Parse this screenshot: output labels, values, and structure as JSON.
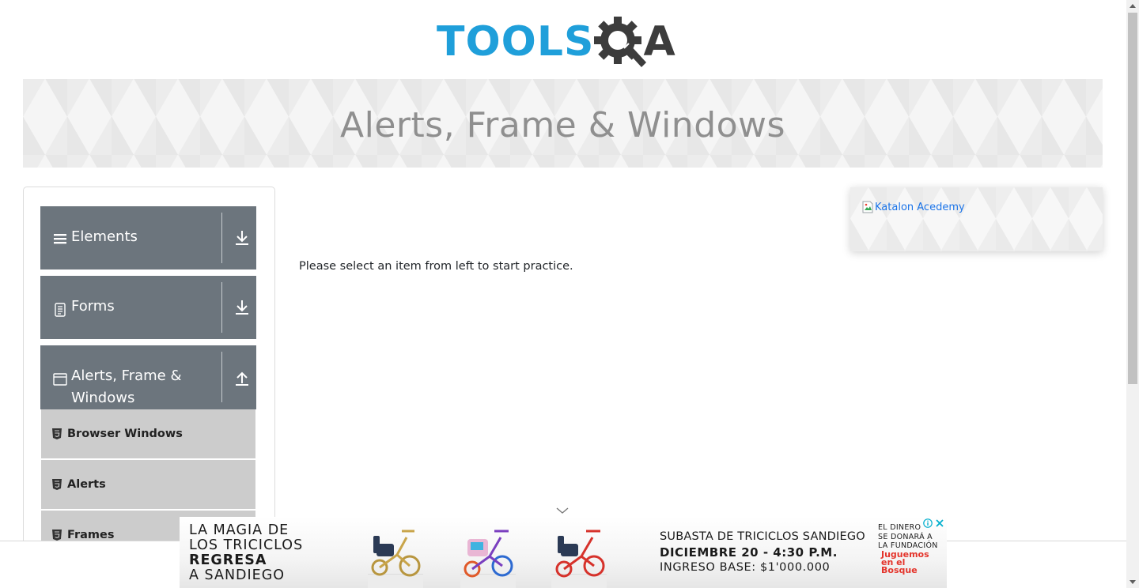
{
  "header": {
    "logo_tools": "TOOLS",
    "logo_qa": "A",
    "logo_colors": {
      "tools": "#1f9fda",
      "qa": "#3c3c3c"
    }
  },
  "banner": {
    "title": "Alerts, Frame & Windows"
  },
  "sidebar": {
    "groups": [
      {
        "label": "Elements",
        "icon": "hamburger-icon",
        "toggle_icon": "download-arrow-icon",
        "expanded": false
      },
      {
        "label": "Forms",
        "icon": "document-icon",
        "toggle_icon": "download-arrow-icon",
        "expanded": false
      },
      {
        "label": "Alerts, Frame & Windows",
        "icon": "window-icon",
        "toggle_icon": "upload-arrow-icon",
        "expanded": true
      }
    ],
    "sub_items": [
      {
        "label": "Browser Windows",
        "icon": "html5-icon"
      },
      {
        "label": "Alerts",
        "icon": "html5-icon"
      },
      {
        "label": "Frames",
        "icon": "html5-icon"
      }
    ],
    "group_color": "#6c757d",
    "sub_item_color": "#cccccc"
  },
  "main": {
    "instruction": "Please select an item from left to start practice."
  },
  "side_ad": {
    "image_alt": "Katalon Acedemy"
  },
  "bottom_ad": {
    "left_lines": [
      "LA MAGIA DE",
      "LOS TRICICLOS",
      "REGRESA",
      "A SANDIEGO"
    ],
    "middle_lines": [
      "SUBASTA DE TRICICLOS SANDIEGO",
      "DICIEMBRE 20 - 4:30 P.M.",
      "INGRESO BASE: $1'000.000"
    ],
    "right_lines": [
      "EL DINERO",
      "SE DONARÁ A",
      "LA FUNDACIÓN"
    ],
    "brand_lines": [
      "Juguemos",
      "en el",
      "Bosque"
    ],
    "accent_color": "#e4342b"
  }
}
